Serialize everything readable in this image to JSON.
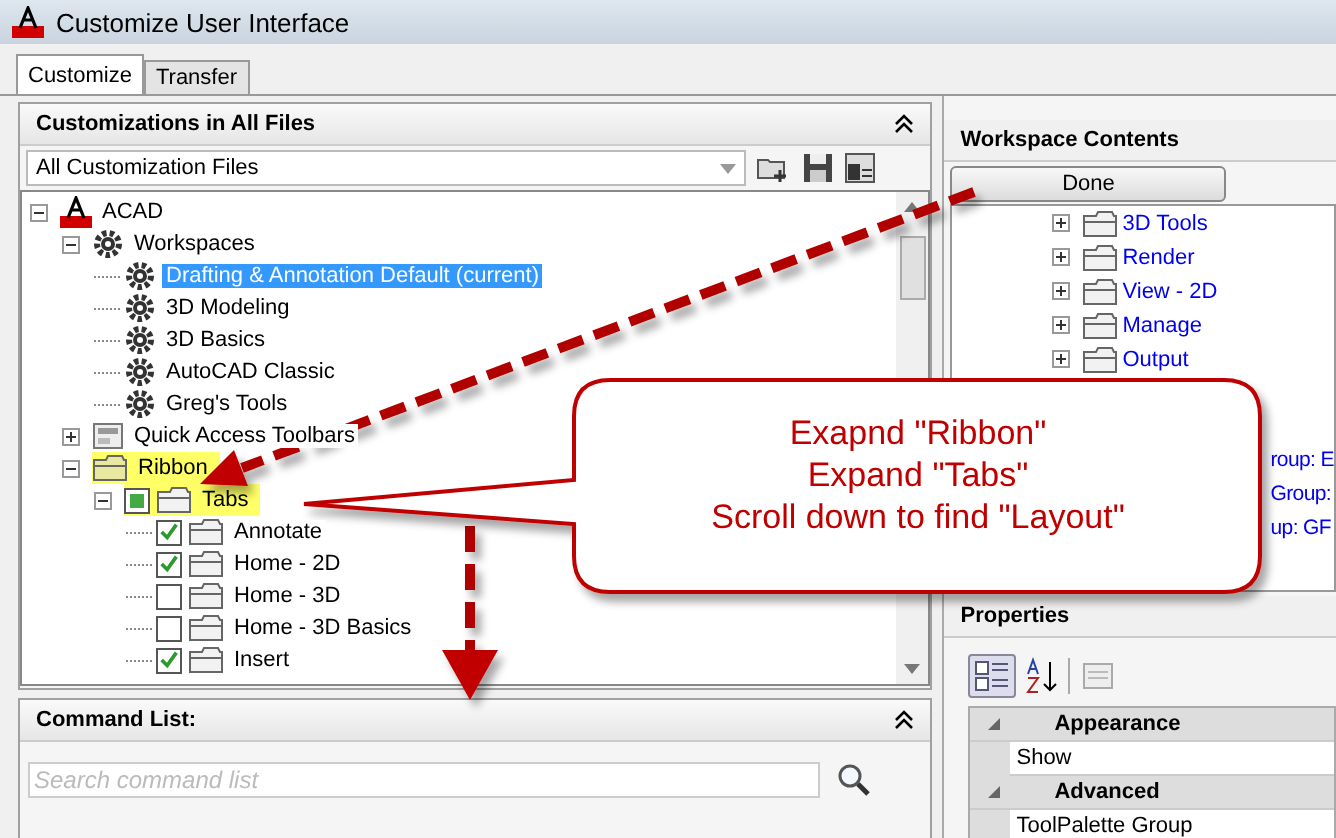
{
  "window": {
    "title": "Customize User Interface"
  },
  "tabs": [
    {
      "label": "Customize",
      "selected": true
    },
    {
      "label": "Transfer",
      "selected": false
    }
  ],
  "customizations": {
    "title": "Customizations in All Files",
    "file_filter": "All Customization Files",
    "tree": [
      {
        "kind": "acad",
        "label": "ACAD",
        "expanded": true,
        "children": [
          {
            "kind": "workspaces",
            "label": "Workspaces",
            "expanded": true,
            "children": [
              {
                "kind": "workspace",
                "label": "Drafting & Annotation Default (current)",
                "selected": true
              },
              {
                "kind": "workspace",
                "label": "3D Modeling",
                "selected": false
              },
              {
                "kind": "workspace",
                "label": "3D Basics",
                "selected": false
              },
              {
                "kind": "workspace",
                "label": "AutoCAD Classic",
                "selected": false
              },
              {
                "kind": "workspace",
                "label": "Greg's Tools",
                "selected": false
              }
            ]
          },
          {
            "kind": "toolbars",
            "label": "Quick Access Toolbars",
            "expanded": false
          },
          {
            "kind": "folder",
            "label": "Ribbon",
            "expanded": true,
            "highlighted": true,
            "children": [
              {
                "kind": "tabs",
                "label": "Tabs",
                "expanded": true,
                "highlighted": true,
                "checked": false,
                "mixed": true,
                "children": [
                  {
                    "kind": "tab",
                    "label": "Annotate",
                    "checked": true
                  },
                  {
                    "kind": "tab",
                    "label": "Home - 2D",
                    "checked": true
                  },
                  {
                    "kind": "tab",
                    "label": "Home - 3D",
                    "checked": false
                  },
                  {
                    "kind": "tab",
                    "label": "Home - 3D Basics",
                    "checked": false
                  },
                  {
                    "kind": "tab",
                    "label": "Insert",
                    "checked": true
                  }
                ]
              }
            ]
          }
        ]
      }
    ]
  },
  "command_list": {
    "title": "Command List:",
    "search": {
      "placeholder": "Search command list"
    }
  },
  "workspace_contents": {
    "title": "Workspace Contents",
    "button": "Done",
    "tree": [
      {
        "label": "3D Tools",
        "expanded": false
      },
      {
        "label": "Render",
        "expanded": false
      },
      {
        "label": "View - 2D",
        "expanded": false
      },
      {
        "label": "Manage",
        "expanded": false
      },
      {
        "label": "Output",
        "expanded": false
      }
    ],
    "partial_rows": [
      "roup: E",
      "Group:",
      "up: GF"
    ]
  },
  "properties": {
    "title": "Properties",
    "categories": [
      {
        "name": "Appearance",
        "rows": [
          "Show"
        ]
      },
      {
        "name": "Advanced",
        "rows": [
          "ToolPalette Group"
        ]
      }
    ]
  },
  "callout": {
    "lines": [
      "Exapnd \"Ribbon\"",
      "Expand \"Tabs\"",
      "Scroll down to find \"Layout\""
    ]
  }
}
